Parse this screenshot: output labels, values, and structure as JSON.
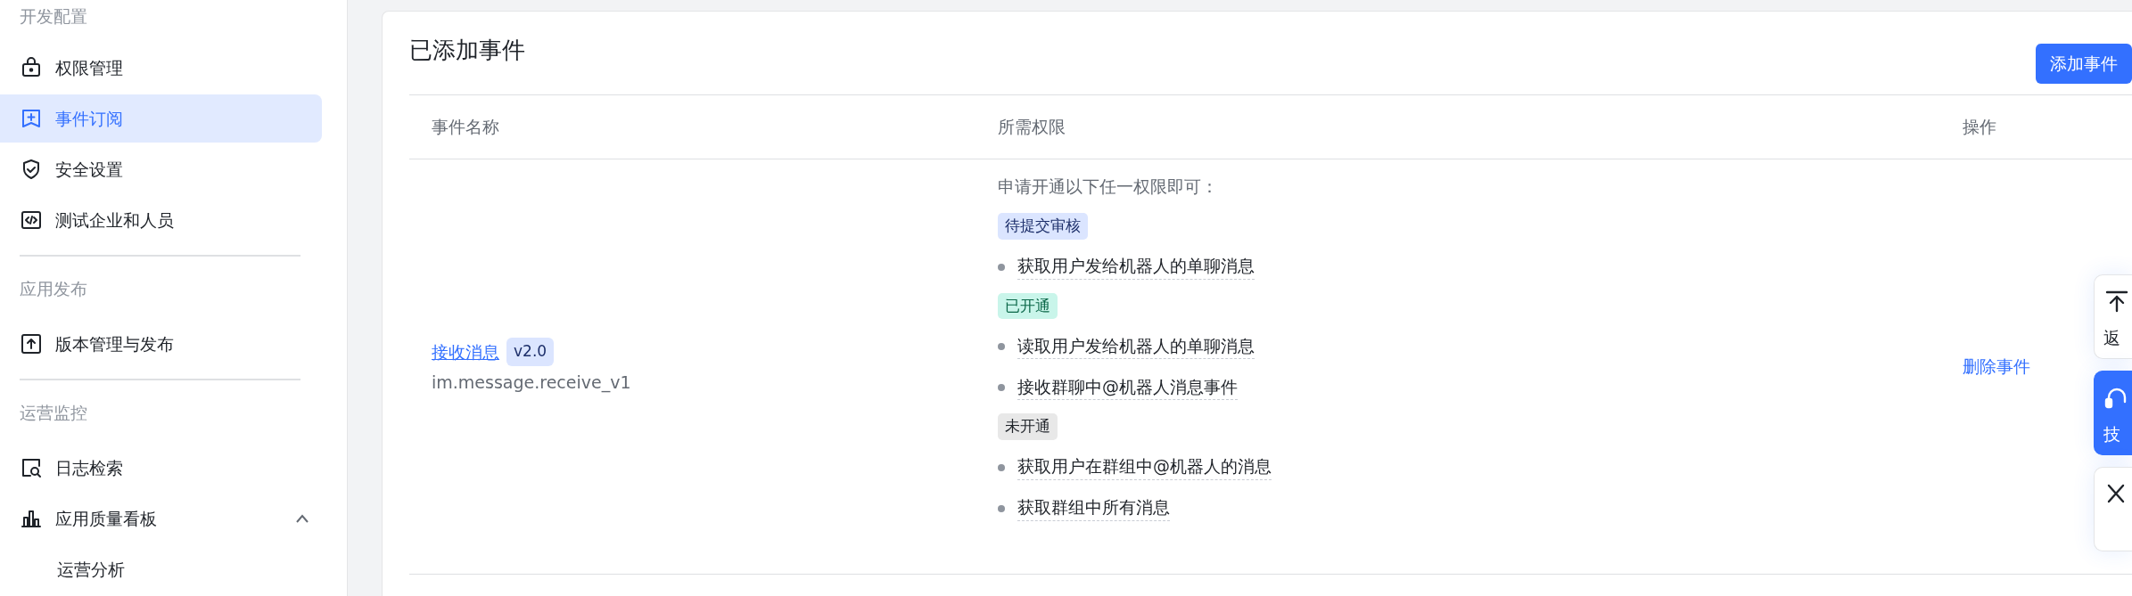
{
  "sidebar": {
    "sections": [
      {
        "title": "开发配置",
        "items": [
          {
            "label": "权限管理",
            "selected": false
          },
          {
            "label": "事件订阅",
            "selected": true
          },
          {
            "label": "安全设置",
            "selected": false
          },
          {
            "label": "测试企业和人员",
            "selected": false
          }
        ]
      },
      {
        "title": "应用发布",
        "items": [
          {
            "label": "版本管理与发布",
            "selected": false
          }
        ]
      },
      {
        "title": "运营监控",
        "items": [
          {
            "label": "日志检索",
            "selected": false
          },
          {
            "label": "应用质量看板",
            "selected": false,
            "expanded": true,
            "children": [
              {
                "label": "运营分析",
                "selected": false
              }
            ]
          }
        ]
      }
    ]
  },
  "card": {
    "title": "已添加事件",
    "add_button": "添加事件",
    "table": {
      "columns": [
        "事件名称",
        "所需权限",
        "操作"
      ],
      "rows": [
        {
          "event_name": "接收消息",
          "version": "v2.0",
          "event_key": "im.message.receive_v1",
          "permission_intro": "申请开通以下任一权限即可：",
          "permission_groups": [
            {
              "kind": "pending",
              "label": "待提交审核",
              "items": [
                "获取用户发给机器人的单聊消息"
              ]
            },
            {
              "kind": "granted",
              "label": "已开通",
              "items": [
                "读取用户发给机器人的单聊消息",
                "接收群聊中@机器人消息事件"
              ]
            },
            {
              "kind": "none",
              "label": "未开通",
              "items": [
                "获取用户在群组中@机器人的消息",
                "获取群组中所有消息"
              ]
            }
          ],
          "action": "删除事件"
        }
      ]
    }
  },
  "float_buttons": [
    {
      "kind": "top",
      "label": "返",
      "selected": false
    },
    {
      "kind": "support",
      "label": "技",
      "selected": true
    },
    {
      "kind": "collapse",
      "selected": false
    }
  ]
}
